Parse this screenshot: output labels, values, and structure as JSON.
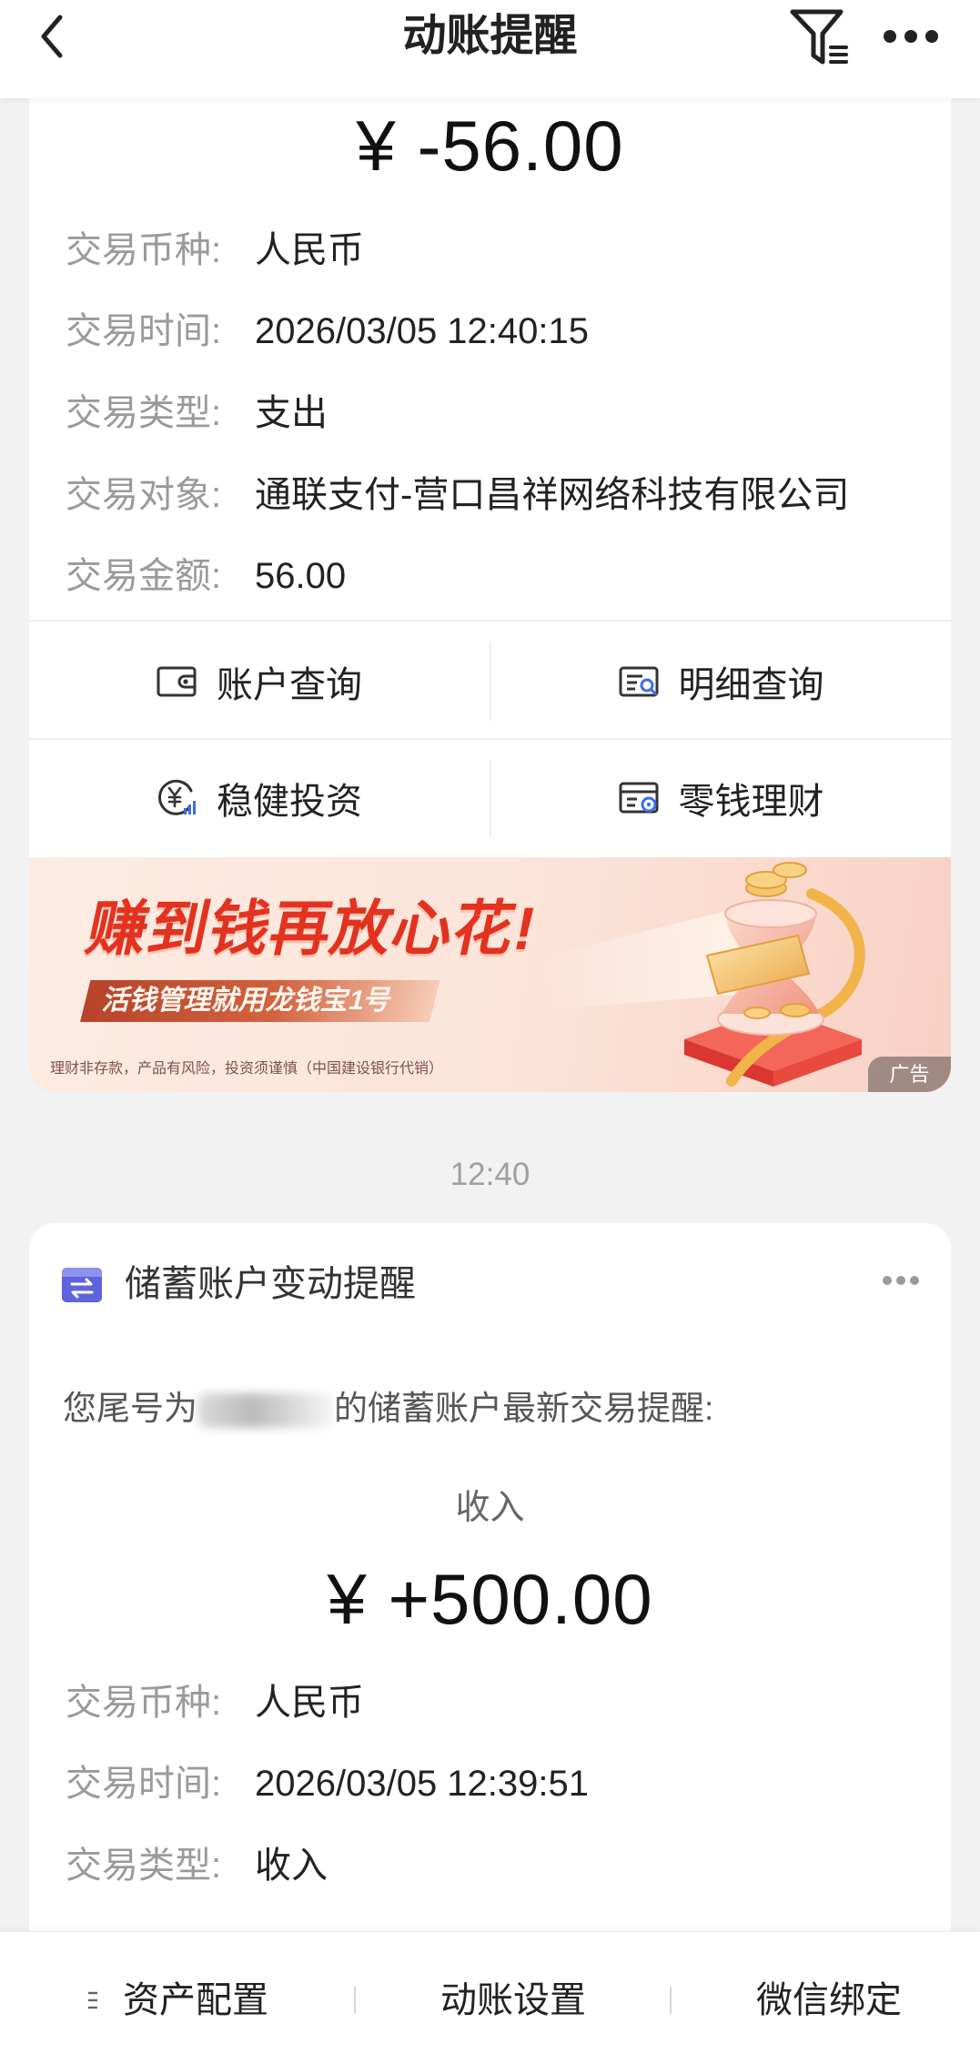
{
  "header": {
    "title": "动账提醒",
    "icons": {
      "back": "chevron-left-icon",
      "filter": "filter-list-icon",
      "more": "more-horizontal-icon"
    }
  },
  "expense_card": {
    "amount": "¥ -56.00",
    "rows": [
      {
        "label": "交易币种:",
        "value": "人民币"
      },
      {
        "label": "交易时间:",
        "value": "2026/03/05 12:40:15"
      },
      {
        "label": "交易类型:",
        "value": "支出"
      },
      {
        "label": "交易对象:",
        "value": "通联支付-营口昌祥网络科技有限公司"
      },
      {
        "label": "交易金额:",
        "value": "56.00"
      }
    ],
    "actions": [
      {
        "label": "账户查询",
        "icon": "wallet-icon"
      },
      {
        "label": "明细查询",
        "icon": "detail-search-icon"
      },
      {
        "label": "稳健投资",
        "icon": "yuan-investment-icon"
      },
      {
        "label": "零钱理财",
        "icon": "wealth-management-icon"
      }
    ],
    "ad": {
      "headline": "赚到钱再放心花!",
      "subline": "活钱管理就用龙钱宝1号",
      "disclaimer": "理财非存款，产品有风险，投资须谨慎（中国建设银行代销）",
      "badge": "广告",
      "illustration": "hourglass-coins-illustration"
    }
  },
  "timestamp": "12:40",
  "savings_card": {
    "title": "储蓄账户变动提醒",
    "icon": "transfer-arrows-icon",
    "more_icon": "more-horizontal-icon",
    "intro_prefix": "您尾号为",
    "intro_suffix": "的储蓄账户最新交易提醒:",
    "direction": "收入",
    "amount": "¥ +500.00",
    "rows": [
      {
        "label": "交易币种:",
        "value": "人民币"
      },
      {
        "label": "交易时间:",
        "value": "2026/03/05 12:39:51"
      },
      {
        "label": "交易类型:",
        "value": "收入"
      }
    ]
  },
  "bottom_bar": {
    "items": [
      {
        "label": "资产配置",
        "icon": "menu-lines-icon"
      },
      {
        "label": "动账设置"
      },
      {
        "label": "微信绑定"
      }
    ]
  },
  "colors": {
    "page_background": "#f2f2f2",
    "card_background": "#ffffff",
    "label_text": "#9a9a9a",
    "value_text": "#222222",
    "accent_blue": "#3d6fe3",
    "ad_headline_red": "#e3321f",
    "card_icon_indigo": "#5f63e0"
  }
}
